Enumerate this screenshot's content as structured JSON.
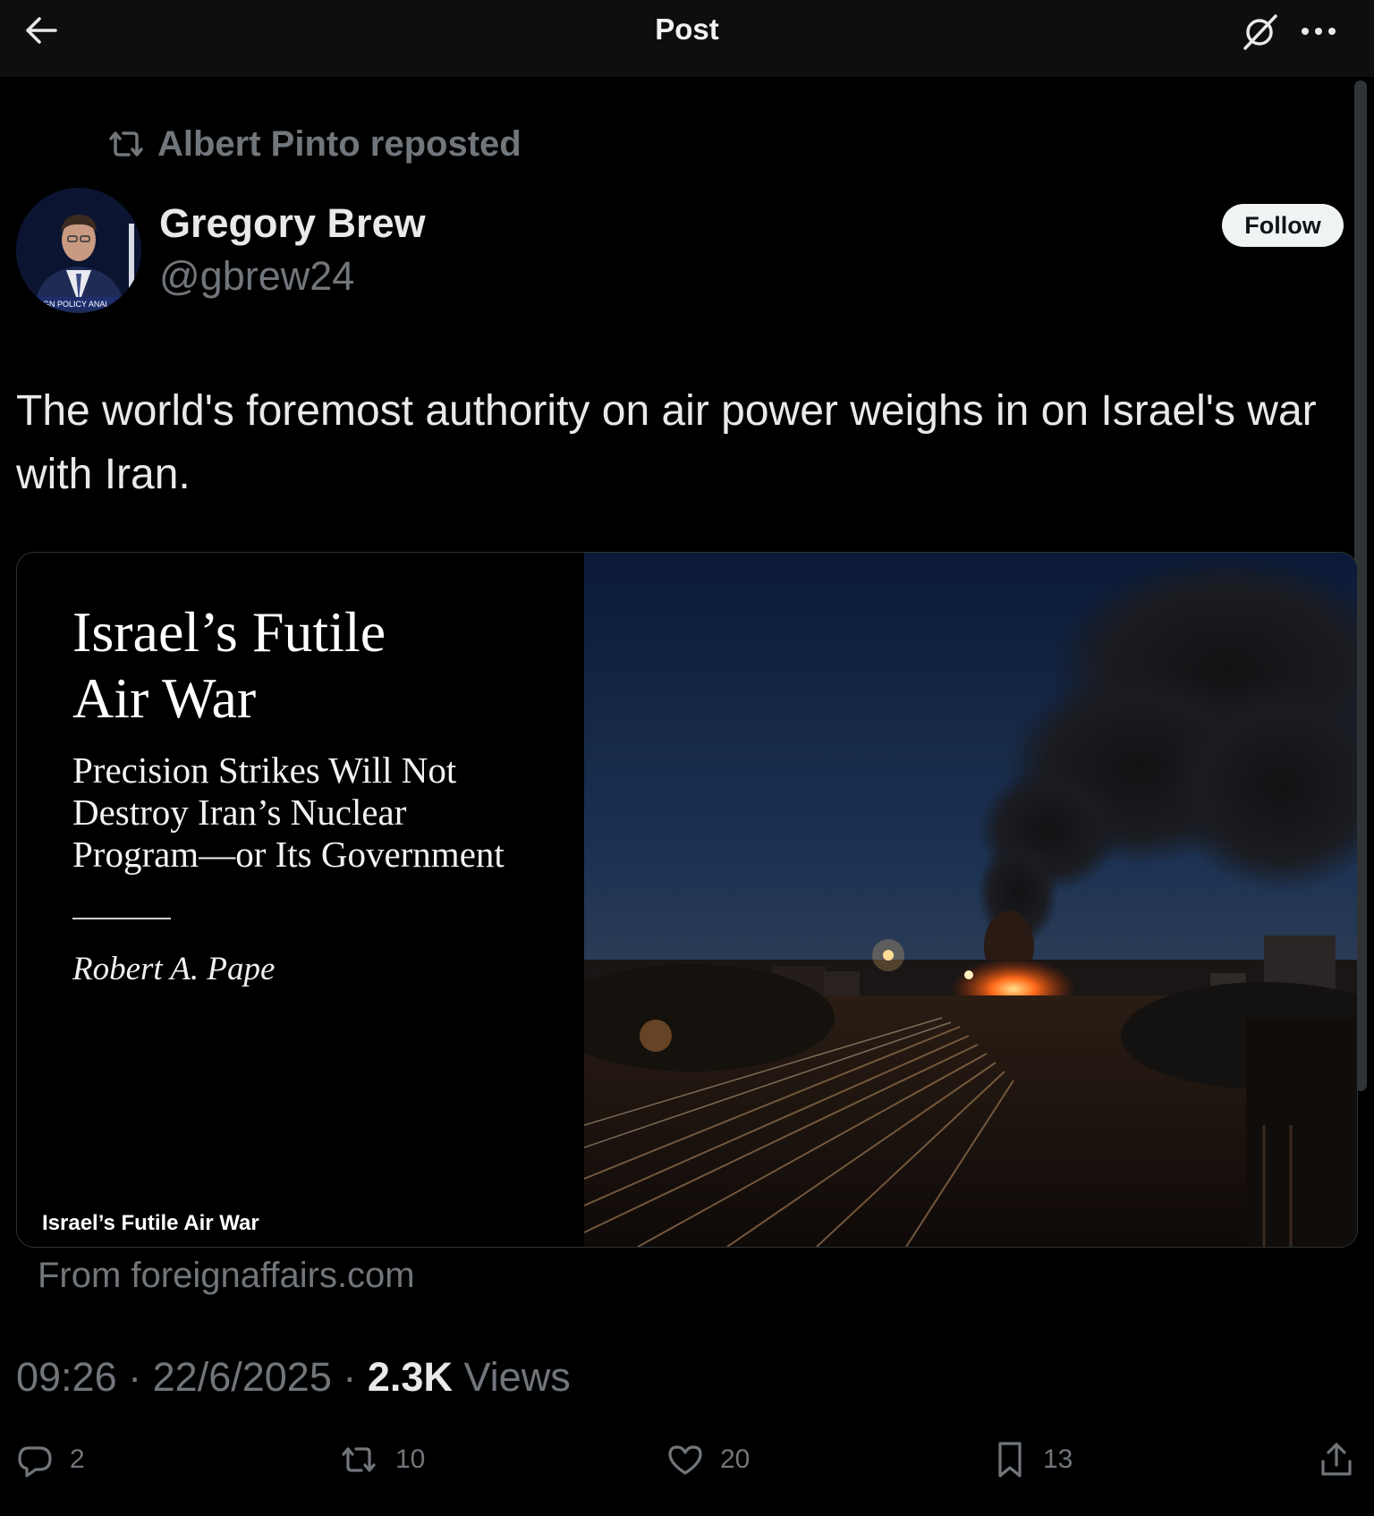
{
  "header": {
    "title": "Post",
    "back_icon": "arrow-left-icon",
    "grok_icon": "grok-icon",
    "more_icon": "more-dots-icon"
  },
  "repost": {
    "label": "Albert Pinto reposted",
    "icon": "repost-icon"
  },
  "author": {
    "name": "Gregory Brew",
    "handle": "@gbrew24",
    "avatar_caption": "GN POLICY ANAL",
    "follow_label": "Follow"
  },
  "post": {
    "text": "The world's foremost authority on air power weighs in on Israel's war with Iran."
  },
  "card": {
    "headline_line1": "Israel’s Futile",
    "headline_line2": "Air War",
    "subtitle_line1": "Precision Strikes Will Not",
    "subtitle_line2": "Destroy Iran’s Nuclear",
    "subtitle_line3": "Program—or Its Government",
    "byline": "Robert A. Pape",
    "label": "Israel’s Futile Air War",
    "source": "From foreignaffairs.com"
  },
  "meta": {
    "time": "09:26",
    "date": "22/6/2025",
    "views_count": "2.3K",
    "views_label": "Views",
    "separator": "·"
  },
  "actions": {
    "replies": "2",
    "reposts": "10",
    "likes": "20",
    "bookmarks": "13"
  },
  "colors": {
    "background": "#000000",
    "secondary_text": "#71767b",
    "primary_text": "#e7e9ea",
    "follow_bg": "#eff3f4"
  }
}
